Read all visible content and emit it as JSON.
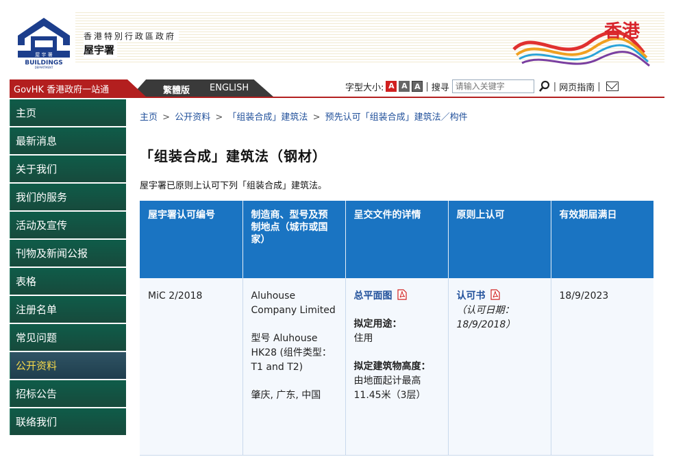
{
  "header": {
    "dept_name_line1": "香港特別行政區政府",
    "dept_name_line2": "屋宇署",
    "logo_text_cn": "屋 宇 署",
    "logo_text_en": "BUILDINGS",
    "logo_subtext_en": "DEPARTMENT",
    "brand_text": "香港"
  },
  "topbar": {
    "govhk_label": "GovHK 香港政府一站通",
    "trad_label": "繁體版",
    "english_label": "ENGLISH",
    "font_size_label": "字型大小:",
    "font_sizes": [
      "A",
      "A",
      "A"
    ],
    "search_label": "搜寻",
    "search_placeholder": "请输入关键字",
    "guide_label": "网页指南"
  },
  "sidebar": {
    "items": [
      {
        "label": "主页"
      },
      {
        "label": "最新消息"
      },
      {
        "label": "关于我们"
      },
      {
        "label": "我们的服务"
      },
      {
        "label": "活动及宣传"
      },
      {
        "label": "刊物及新闻公报"
      },
      {
        "label": "表格"
      },
      {
        "label": "注册名单"
      },
      {
        "label": "常见问题"
      },
      {
        "label": "公开资料"
      },
      {
        "label": "招标公告"
      },
      {
        "label": "联络我们"
      }
    ],
    "active_index": 9
  },
  "breadcrumb": {
    "items": [
      "主页",
      "公开资料",
      "「组装合成」建筑法",
      "预先认可「组装合成」建筑法／构件"
    ],
    "separator": ">"
  },
  "main": {
    "title": "「组装合成」建筑法（钢材）",
    "intro": "屋宇署已原则上认可下列「组装合成」建筑法。"
  },
  "table": {
    "headers": [
      "屋宇署认可编号",
      "制造商、型号及预制地点（城市或国家）",
      "呈交文件的详情",
      "原则上认可",
      "有效期届满日"
    ],
    "rows": [
      {
        "approval_no": "MiC 2/2018",
        "manufacturer": "Aluhouse Company Limited",
        "model": "型号 Aluhouse HK28 (组件类型：T1 and T2)",
        "location": "肇庆, 广东, 中国",
        "doc_link": "总平面图",
        "usage_label": "拟定用途：",
        "usage_value": "住用",
        "height_label": "拟定建筑物高度：",
        "height_value": "由地面起计最高11.45米（3层）",
        "approval_link": "认可书",
        "approval_date": "（认可日期：18/9/2018）",
        "expiry": "18/9/2023"
      }
    ]
  },
  "colors": {
    "header_blue": "#1a74c2",
    "sidebar_green": "#0f5c49",
    "sidebar_active_text": "#f5d94a",
    "govhk_red": "#b31f1f",
    "link_blue": "#1f4f9a"
  }
}
